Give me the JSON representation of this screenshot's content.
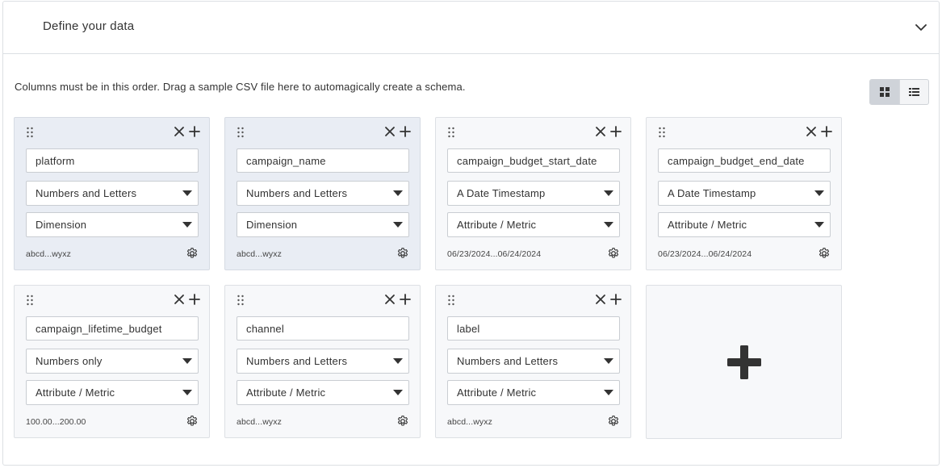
{
  "panel": {
    "title": "Define your data",
    "instructions": "Columns must be in this order. Drag a sample CSV file here to automagically create a schema."
  },
  "view_toggle": {
    "selected": "grid-view"
  },
  "columns": [
    {
      "name": "platform",
      "type": "Numbers and Letters",
      "role": "Dimension",
      "sample": "abcd...wyxz"
    },
    {
      "name": "campaign_name",
      "type": "Numbers and Letters",
      "role": "Dimension",
      "sample": "abcd...wyxz"
    },
    {
      "name": "campaign_budget_start_date",
      "type": "A Date Timestamp",
      "role": "Attribute / Metric",
      "sample": "06/23/2024...06/24/2024"
    },
    {
      "name": "campaign_budget_end_date",
      "type": "A Date Timestamp",
      "role": "Attribute / Metric",
      "sample": "06/23/2024...06/24/2024"
    },
    {
      "name": "campaign_lifetime_budget",
      "type": "Numbers only",
      "role": "Attribute / Metric",
      "sample": "100.00...200.00"
    },
    {
      "name": "channel",
      "type": "Numbers and Letters",
      "role": "Attribute / Metric",
      "sample": "abcd...wyxz"
    },
    {
      "name": "label",
      "type": "Numbers and Letters",
      "role": "Attribute / Metric",
      "sample": "abcd...wyxz"
    }
  ],
  "colors": {
    "card_bg": "#f7f8fa",
    "card_selected_bg": "#e9edf4",
    "border": "#dcdfe3",
    "icon": "#333333"
  },
  "icons": {
    "collapse": "chevron-down-icon",
    "grid": "grid-view-icon",
    "list": "list-view-icon",
    "drag": "drag-handle-icon",
    "remove": "close-icon",
    "add": "plus-icon",
    "settings": "gear-icon",
    "add_column": "plus-icon"
  }
}
